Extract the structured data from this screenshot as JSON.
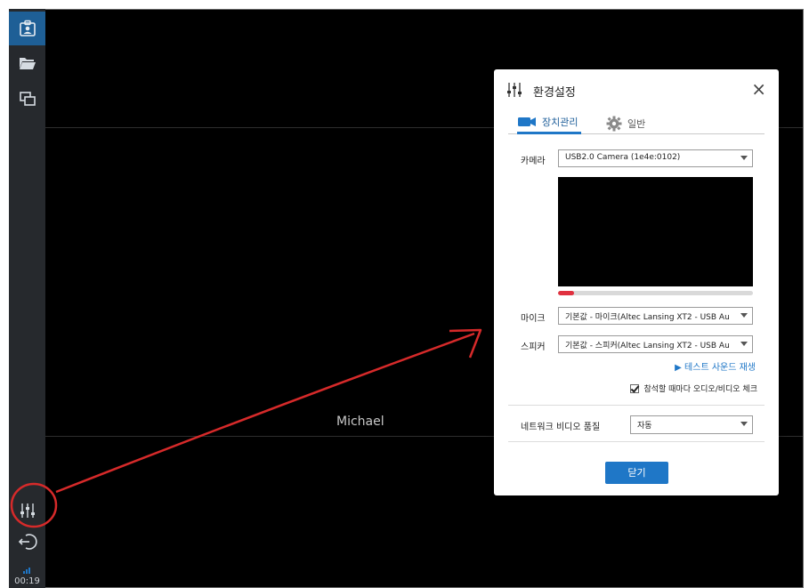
{
  "sidebar": {
    "icons": [
      "contact-card-icon",
      "folder-icon",
      "screen-share-icon",
      "settings-sliders-icon",
      "exit-icon",
      "signal-icon"
    ],
    "time": "00:19"
  },
  "stage": {
    "participant_name": "Michael"
  },
  "dialog": {
    "title": "환경설정",
    "close_glyph": "×",
    "tabs": [
      {
        "label": "장치관리",
        "icon": "video-camera-icon",
        "active": true
      },
      {
        "label": "일반",
        "icon": "gear-icon",
        "active": false
      }
    ],
    "camera": {
      "label": "카메라",
      "value": "USB2.0 Camera (1e4e:0102)"
    },
    "mic": {
      "label": "마이크",
      "value": "기본값 - 마이크(Altec Lansing XT2 - USB Au"
    },
    "mic_level": 0.08,
    "speaker": {
      "label": "스피커",
      "value": "기본값 - 스피커(Altec Lansing XT2 - USB Au"
    },
    "test_sound": "▶ 테스트 사운드 재생",
    "check_on_join": {
      "label": "참석할 때마다 오디오/비디오 체크",
      "checked": true
    },
    "network_quality": {
      "label": "네트워크 비디오 품질",
      "value": "자동"
    },
    "close_button": "닫기"
  },
  "colors": {
    "accent": "#1f77c7",
    "annotation": "#d62a2a",
    "sidebar_bg": "#26292d",
    "active_tab_bg": "#1e5f96"
  }
}
